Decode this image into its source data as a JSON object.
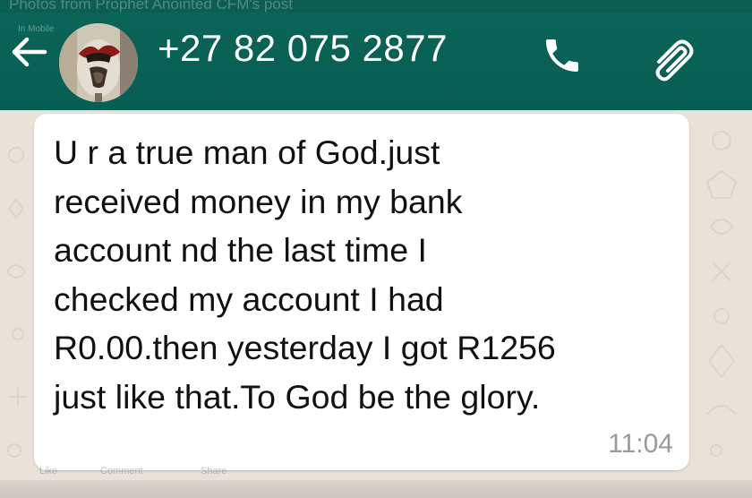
{
  "overlay": {
    "title": "Photos from Prophet Anointed CFM's post",
    "subtitle": "In Mobile"
  },
  "header": {
    "contact": "+27 82 075 2877",
    "back_icon": "arrow-left-icon",
    "call_icon": "phone-icon",
    "attach_icon": "paperclip-icon",
    "color": "#075e54"
  },
  "message": {
    "text": "U r a true man of God.just\nreceived money in my bank\naccount nd the last time I\nchecked my account I had\nR0.00.then yesterday I got R1256\njust like that.To God be the glory.",
    "time": "11:04"
  },
  "footer": {
    "like": "Like",
    "comment": "Comment",
    "share": "Share"
  }
}
